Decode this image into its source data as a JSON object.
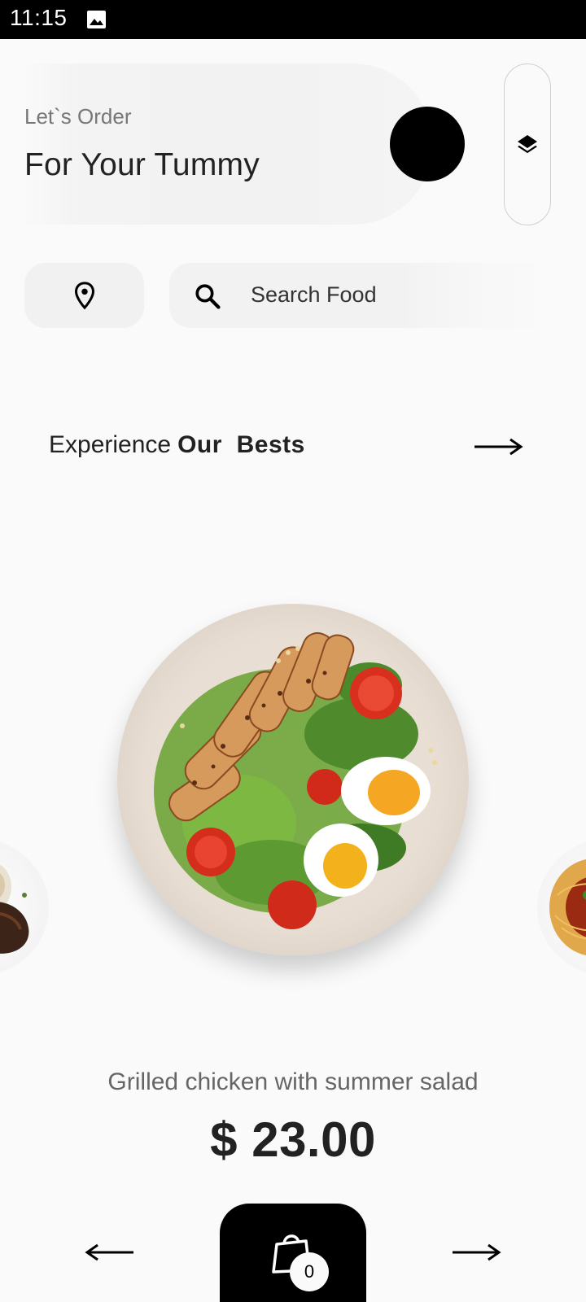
{
  "status_bar": {
    "time": "11:15",
    "icons": [
      "image-icon"
    ]
  },
  "header": {
    "subtitle": "Let`s Order",
    "title": "For Your Tummy",
    "icons": [
      "avatar",
      "layers-icon"
    ]
  },
  "search": {
    "placeholder": "Search Food",
    "icons": [
      "location-pin-icon",
      "search-icon"
    ]
  },
  "section": {
    "prefix": "Experience",
    "emphasis": "Our  Bests",
    "icon": "arrow-right-icon"
  },
  "featured": {
    "name": "Grilled chicken with summer salad",
    "price": "$ 23.00"
  },
  "bottom_nav": {
    "cart_count": "0",
    "icons": [
      "arrow-left-icon",
      "shopping-bag-icon",
      "arrow-right-icon"
    ]
  },
  "colors": {
    "background": "#fafafa",
    "primary": "#000000",
    "text": "#222222",
    "muted": "#777777"
  }
}
